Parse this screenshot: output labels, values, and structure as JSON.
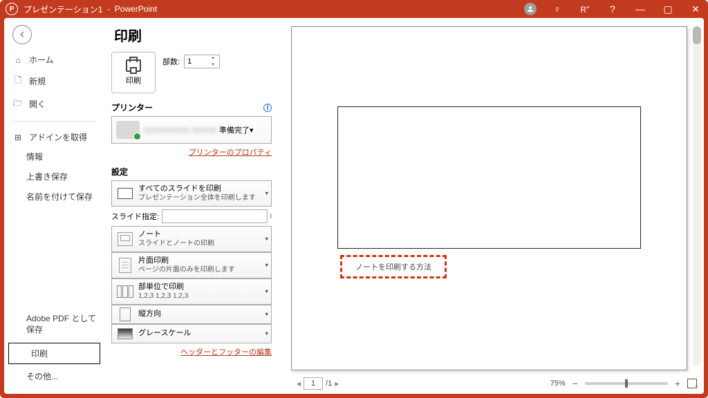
{
  "titlebar": {
    "doc": "プレゼンテーション1",
    "app": "PowerPoint"
  },
  "backstage": {
    "home": "ホーム",
    "new": "新規",
    "open": "開く",
    "getaddins": "アドインを取得",
    "info": "情報",
    "save": "上書き保存",
    "saveas": "名前を付けて保存",
    "adobepdf": "Adobe PDF として保存",
    "print": "印刷",
    "other": "その他..."
  },
  "print": {
    "title": "印刷",
    "button": "印刷",
    "copies_label": "部数:",
    "copies_value": "1",
    "printer_head": "プリンター",
    "printer_name": "XXXXXXXXX XXXXX",
    "printer_status": "準備完了",
    "printer_props": "プリンターのプロパティ",
    "settings_head": "設定",
    "allslides_t": "すべてのスライドを印刷",
    "allslides_s": "プレゼンテーション全体を印刷します",
    "sliderange_label": "スライド指定:",
    "layout_t": "ノート",
    "layout_s": "スライドとノートの印刷",
    "onesided_t": "片面印刷",
    "onesided_s": "ページの片面のみを印刷します",
    "collate_t": "部単位で印刷",
    "collate_s": "1,2,3   1,2,3   1,2,3",
    "orient": "縦方向",
    "color": "グレースケール",
    "headerfooter": "ヘッダーとフッターの編集"
  },
  "preview": {
    "note_text": "ノートを印刷する方法",
    "page_current": "1",
    "page_total": "/1",
    "zoom": "75%"
  }
}
